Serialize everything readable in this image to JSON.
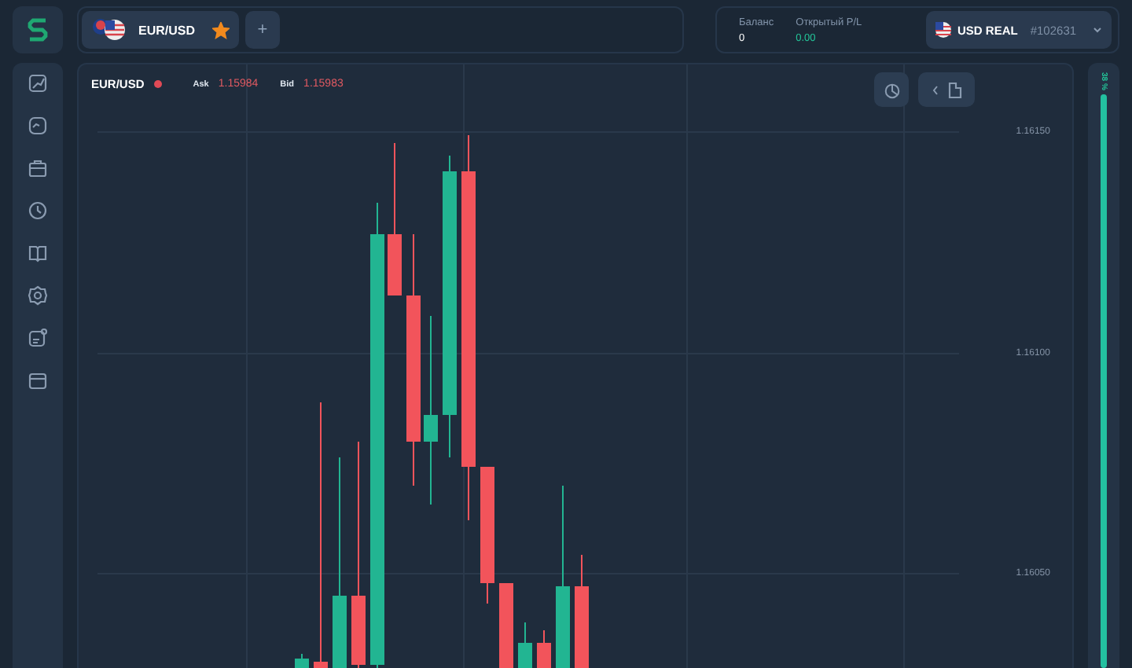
{
  "tab": {
    "pair": "EUR/USD",
    "favorite": true
  },
  "add_tab": {
    "label": "+"
  },
  "balance": {
    "label": "Баланс",
    "value": "0"
  },
  "open_pl": {
    "label": "Открытый P/L",
    "value": "0.00"
  },
  "account": {
    "currency": "USD REAL",
    "number": "#102631"
  },
  "sidebar": {
    "items": [
      {
        "kind": "chart"
      },
      {
        "kind": "analytics"
      },
      {
        "kind": "portfolio"
      },
      {
        "kind": "history"
      },
      {
        "kind": "book"
      },
      {
        "kind": "settings"
      },
      {
        "kind": "news"
      },
      {
        "kind": "calendar"
      }
    ]
  },
  "chart": {
    "symbol": "EUR/USD",
    "live": true,
    "ask_label": "Ask",
    "ask": "1.15984",
    "bid_label": "Bid",
    "bid": "1.15983",
    "price_labels": [
      "1.16150",
      "1.16100",
      "1.16050"
    ]
  },
  "sentiment": {
    "label": "38 %",
    "level": 1
  }
}
